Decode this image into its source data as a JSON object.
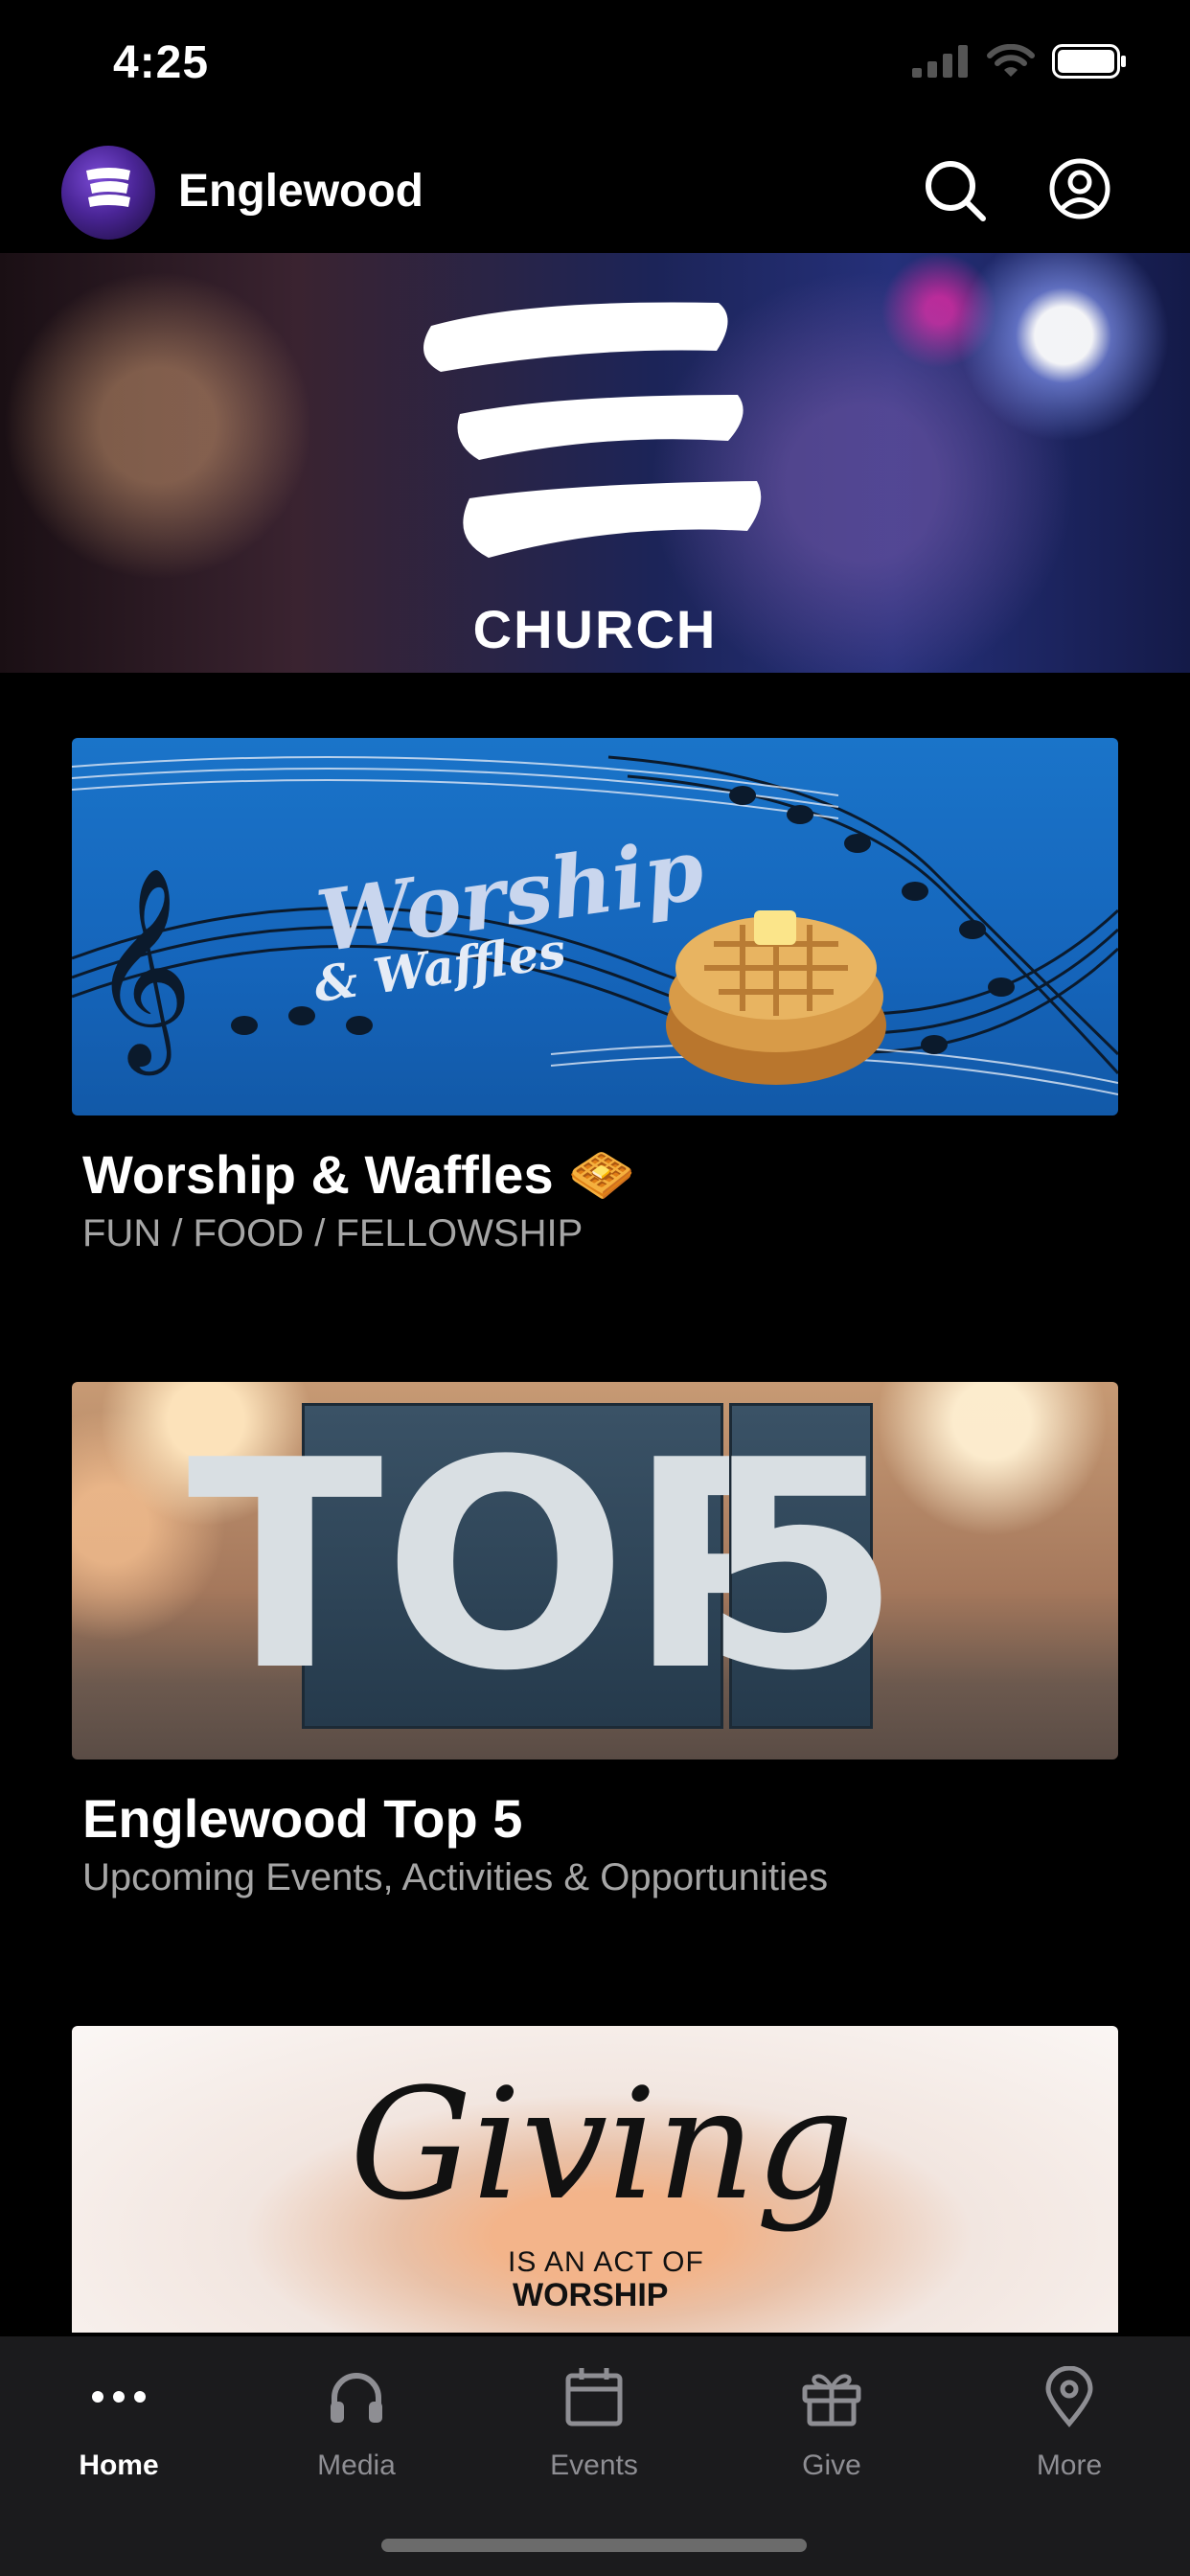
{
  "status": {
    "time": "4:25"
  },
  "header": {
    "title": "Englewood",
    "logo_text": "CHURCH"
  },
  "hero": {
    "caption": "CHURCH"
  },
  "cards": [
    {
      "title": "Worship & Waffles 🧇",
      "subtitle": "FUN / FOOD / FELLOWSHIP",
      "image_text": {
        "line1": "Worship",
        "line2": "& Waffles"
      }
    },
    {
      "title": "Englewood Top 5",
      "subtitle": "Upcoming Events, Activities & Opportunities",
      "image_text": {
        "word1": "TOP",
        "word2": "5"
      }
    },
    {
      "image_text": {
        "script": "Giving",
        "small": "IS AN ACT OF",
        "big": "WORSHIP"
      }
    }
  ],
  "tabs": [
    {
      "label": "Home",
      "icon": "more-dots-icon",
      "active": true
    },
    {
      "label": "Media",
      "icon": "headphones-icon",
      "active": false
    },
    {
      "label": "Events",
      "icon": "calendar-icon",
      "active": false
    },
    {
      "label": "Give",
      "icon": "gift-icon",
      "active": false
    },
    {
      "label": "More",
      "icon": "location-pin-icon",
      "active": false
    }
  ],
  "colors": {
    "background": "#000000",
    "tab_bar": "#1b1b1d",
    "inactive": "#8e8e93",
    "subtitle": "#a6a6a6"
  }
}
